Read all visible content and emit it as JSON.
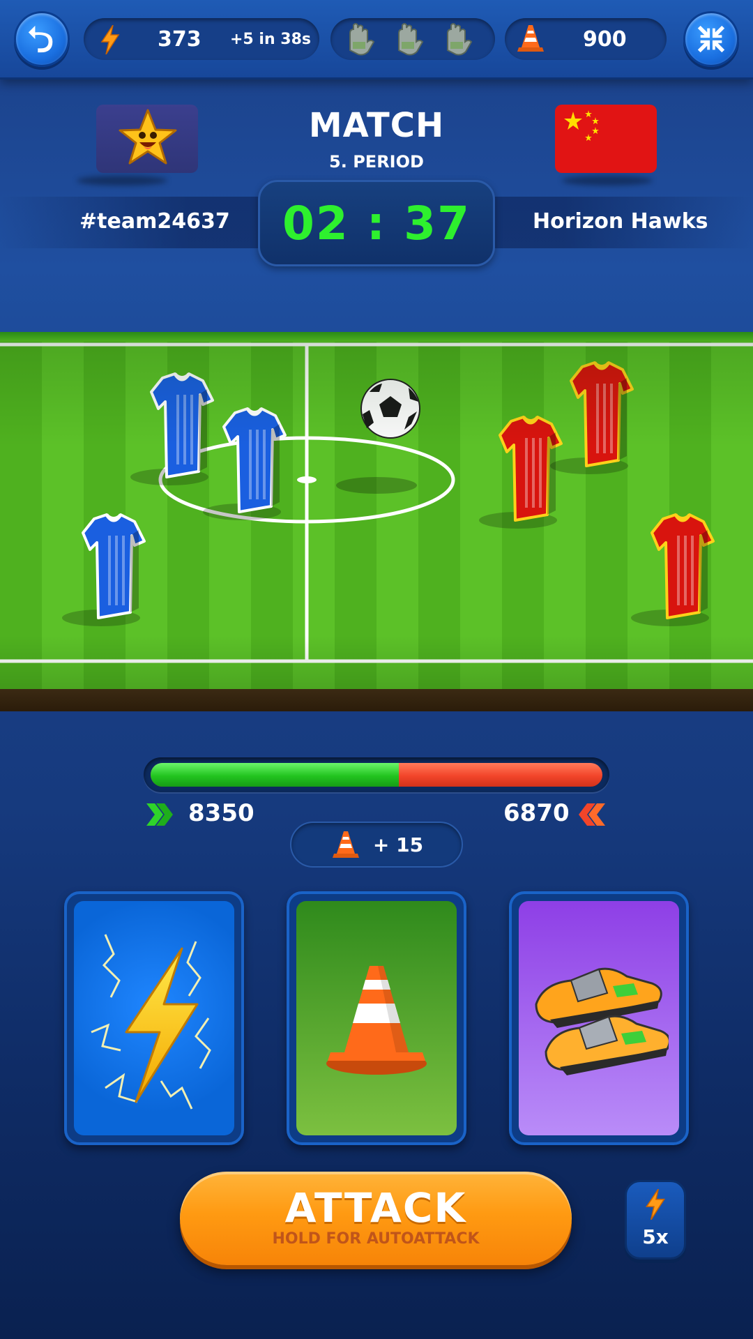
{
  "topbar": {
    "back_icon": "undo-arrow-icon",
    "energy_icon": "lightning-icon",
    "energy_value": "373",
    "energy_refill": "+5 in 38s",
    "gloves_icon": "goalkeeper-glove-icon",
    "gloves_count": 3,
    "cones_icon": "traffic-cone-icon",
    "cones_value": "900",
    "collapse_icon": "collapse-arrows-icon"
  },
  "match": {
    "title": "MATCH",
    "period": "5. PERIOD",
    "timer": "02 : 37",
    "home_team": "#team24637",
    "home_badge_icon": "smiling-star-icon",
    "away_team": "Horizon Hawks",
    "away_badge_icon": "china-flag-icon"
  },
  "field": {
    "home_jersey_color": "#1a5fe0",
    "away_jersey_color": "#d8140e",
    "home_players": 3,
    "away_players": 3,
    "ball_icon": "soccer-ball-icon"
  },
  "strength": {
    "home_score": "8350",
    "away_score": "6870",
    "home_share": 0.55,
    "home_color": "#22c41f",
    "away_color": "#f2452a",
    "bonus_icon": "traffic-cone-icon",
    "bonus_text": "+ 15"
  },
  "cards": [
    {
      "icon": "lightning-bolt-icon",
      "bg": "#0a66d8"
    },
    {
      "icon": "traffic-cone-icon",
      "bg": "#4a9e22"
    },
    {
      "icon": "soccer-cleats-icon",
      "bg": "#a66ef0"
    }
  ],
  "attack": {
    "label": "ATTACK",
    "sublabel": "HOLD FOR AUTOATTACK",
    "multiplier_icon": "lightning-icon",
    "multiplier": "5x"
  }
}
